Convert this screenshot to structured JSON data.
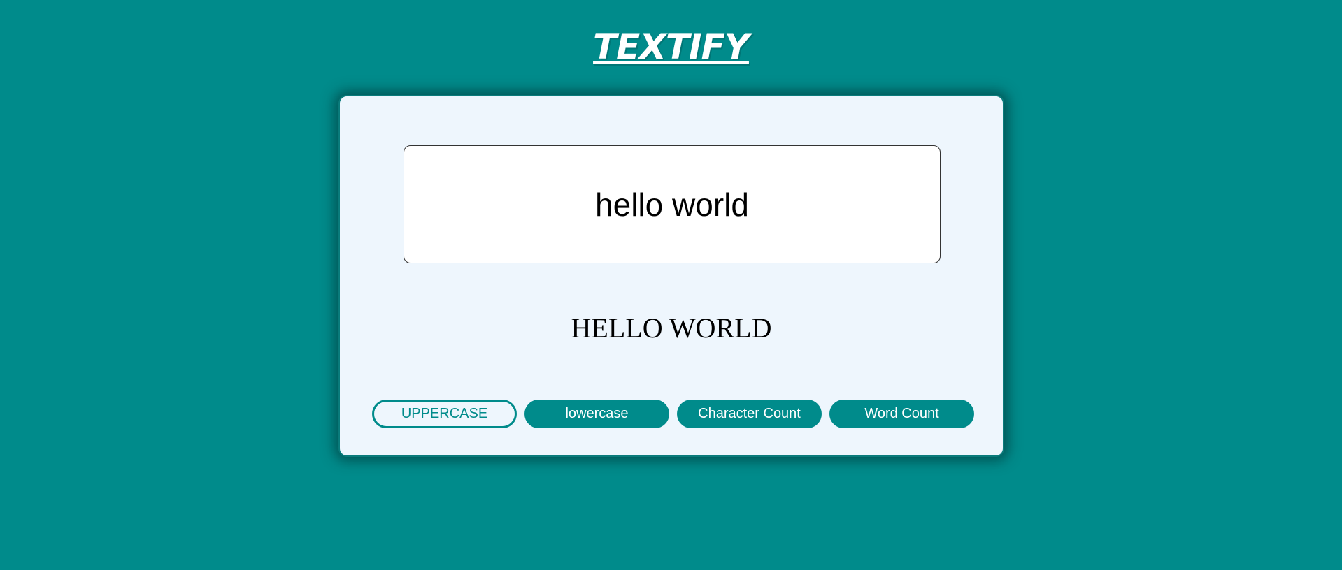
{
  "app": {
    "title": "TEXTIFY"
  },
  "input": {
    "value": "hello world"
  },
  "result": {
    "text": "HELLO WORLD"
  },
  "buttons": {
    "uppercase": "UPPERCASE",
    "lowercase": "lowercase",
    "character_count": "Character Count",
    "word_count": "Word Count"
  },
  "colors": {
    "background": "#008b8b",
    "card": "#eef6fd",
    "accent": "#008b8b"
  }
}
